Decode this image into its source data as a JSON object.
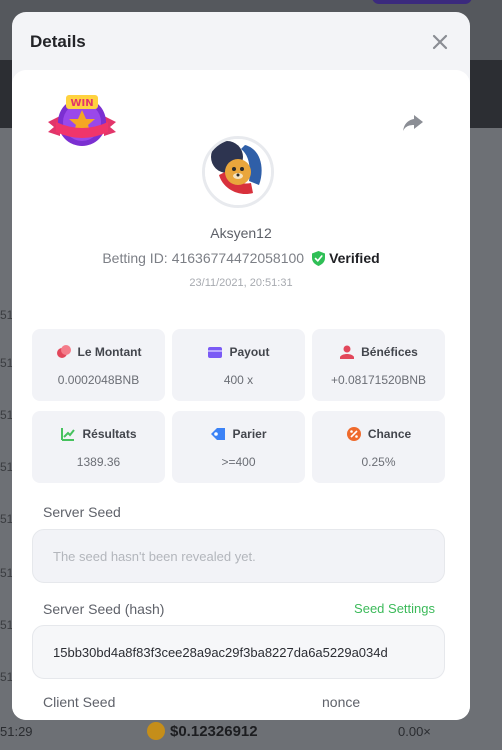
{
  "modal": {
    "title": "Details",
    "username": "Aksyen12",
    "betting_id_label": "Betting ID:",
    "betting_id": "416367744720581​00",
    "verified_label": "Verified",
    "timestamp": "23/11/2021, 20:51:31",
    "win_badge_text": "WIN",
    "stats": [
      {
        "label": "Le Montant",
        "value": "0.0002048BNB",
        "icon": "coins-icon",
        "color": "#e2475b"
      },
      {
        "label": "Payout",
        "value": "400 x",
        "icon": "wallet-icon",
        "color": "#7a5af5"
      },
      {
        "label": "Bénéfices",
        "value": "+0.08171520BNB",
        "icon": "profit-icon",
        "color": "#e2475b"
      },
      {
        "label": "Résultats",
        "value": "1389.36",
        "icon": "chart-icon",
        "color": "#46c25e"
      },
      {
        "label": "Parier",
        "value": ">=400",
        "icon": "tag-icon",
        "color": "#3b82f6"
      },
      {
        "label": "Chance",
        "value": "0.25%",
        "icon": "percent-icon",
        "color": "#ef6a2c"
      }
    ],
    "server_seed": {
      "label": "Server Seed",
      "placeholder": "The seed hasn't been revealed yet."
    },
    "server_seed_hash": {
      "label": "Server Seed (hash)",
      "settings_link": "Seed Settings",
      "value": "15bb30bd4a8f83f3cee28a9ac29f3ba8227da6a5229a034d"
    },
    "client_seed": {
      "label": "Client Seed"
    },
    "nonce": {
      "label": "nonce"
    }
  },
  "background": {
    "row_times": [
      "51:",
      "51:",
      "51:",
      "51:",
      "51:",
      "51:",
      "51:",
      "51:"
    ],
    "footer_time": "51:29",
    "footer_amount": "$0.12326912",
    "footer_multiplier": "0.00×"
  }
}
